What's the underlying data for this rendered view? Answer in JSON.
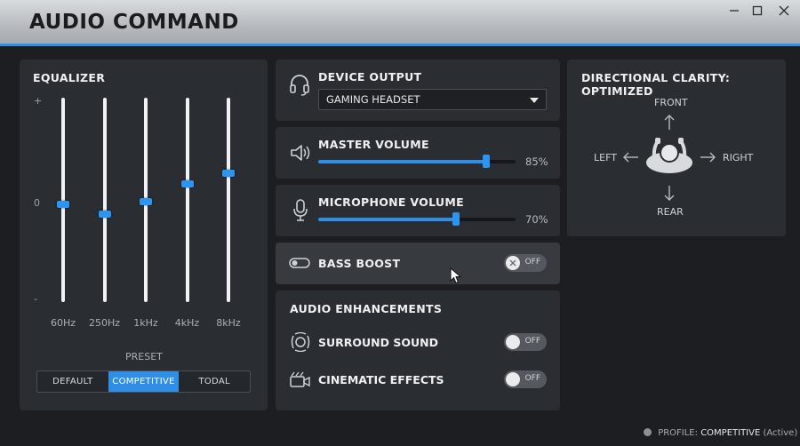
{
  "app": {
    "title": "AUDIO COMMAND",
    "accent": "#2f8fe6",
    "window_controls": [
      "minimize-icon",
      "maximize-icon",
      "close-icon"
    ]
  },
  "equalizer": {
    "title": "EQUALIZER",
    "scale_top": "+",
    "scale_mid": "0",
    "scale_bottom": "-",
    "bands": [
      {
        "label": "60Hz",
        "level": 0.48
      },
      {
        "label": "250Hz",
        "level": 0.43
      },
      {
        "label": "1kHz",
        "level": 0.49
      },
      {
        "label": "4kHz",
        "level": 0.58
      },
      {
        "label": "8kHz",
        "level": 0.63
      }
    ],
    "preset_label": "PRESET",
    "presets": [
      "DEFAULT",
      "COMPETITIVE",
      "TODAL"
    ],
    "active_preset": "COMPETITIVE"
  },
  "device_output": {
    "title": "DEVICE OUTPUT",
    "icon": "headset-icon",
    "selected": "GAMING HEADSET"
  },
  "master_volume": {
    "title": "MASTER VOLUME",
    "icon": "speaker-icon",
    "value": 0.85,
    "percent_text": "85%"
  },
  "microphone_volume": {
    "title": "MICROPHONE VOLUME",
    "icon": "microphone-icon",
    "value": 0.7,
    "percent_text": "70%"
  },
  "bass_boost": {
    "title": "BASS BOOST",
    "icon": "toggle-icon",
    "state_text": "OFF",
    "enabled": false
  },
  "enhancements": {
    "title": "AUDIO ENHANCEMENTS",
    "items": [
      {
        "label": "SURROUND SOUND",
        "icon": "surround-icon",
        "state_text": "OFF",
        "enabled": false
      },
      {
        "label": "CINEMATIC EFFECTS",
        "icon": "camera-icon",
        "state_text": "OFF",
        "enabled": false
      }
    ]
  },
  "directional": {
    "title": "DIRECTIONAL CLARITY: OPTIMIZED",
    "front": "FRONT",
    "rear": "REAR",
    "left": "LEFT",
    "right": "RIGHT",
    "icon": "listener-icon"
  },
  "footer": {
    "prefix": "PROFILE:",
    "profile": "COMPETITIVE",
    "status": "(Active)"
  }
}
